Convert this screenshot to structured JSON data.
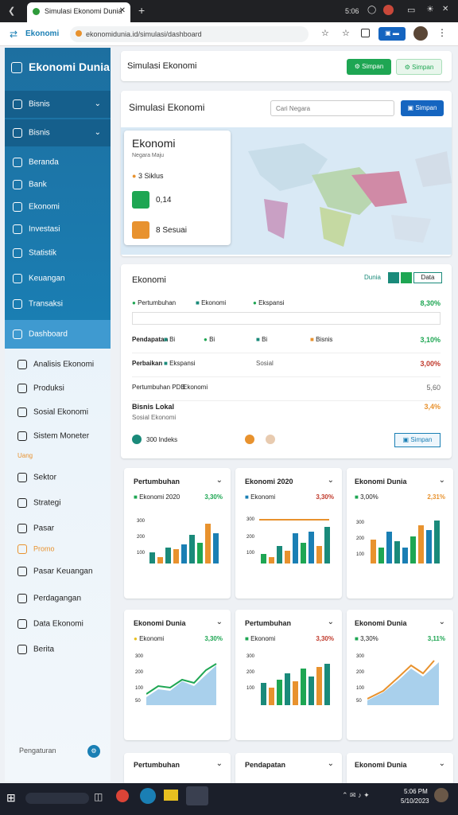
{
  "browser": {
    "tab_title": "Simulasi Ekonomi Dunia",
    "url": "ekonomidunia.id/simulasi/dashboard",
    "time": "5:06"
  },
  "brand": {
    "top_logo": "Ekonomi",
    "sidebar_title": "Ekonomi Dunia"
  },
  "sidebar": {
    "group1": "Bisnis",
    "group2": "Bisnis",
    "items_top": [
      "Beranda",
      "Bank",
      "Ekonomi",
      "Investasi",
      "Statistik",
      "Keuangan",
      "Transaksi"
    ],
    "active": "Dashboard",
    "items_bottom": [
      "Analisis Ekonomi",
      "Produksi",
      "Sosial Ekonomi",
      "Sistem Moneter",
      "Sektor",
      "Strategi",
      "Pasar",
      "Pasar Keuangan",
      "Perdagangan",
      "Data Ekonomi",
      "Berita"
    ],
    "promo_small": "Uang",
    "promo_tag": "Promo",
    "footer": "Pengaturan"
  },
  "header": {
    "title": "Simulasi Ekonomi",
    "btn1": "Simpan",
    "btn2": "Simpan"
  },
  "search": {
    "title": "Simulasi Ekonomi",
    "placeholder": "Cari Negara",
    "btn": "Simpan"
  },
  "map": {
    "heading": "Ekonomi",
    "sub": "Negara Maju",
    "stat1": "3 Siklus",
    "stat2": "0,14",
    "stat3": "8 Sesuai"
  },
  "summary": {
    "title": "Ekonomi",
    "controls": [
      "Dunia",
      "Data"
    ],
    "legend": [
      "Pertumbuhan",
      "Ekonomi",
      "Ekspansi"
    ],
    "legend_value": "8,30%",
    "rows": [
      {
        "label": "Pendapatan",
        "tags": [
          "Bi",
          "Bi",
          "Bi",
          "Bisnis"
        ],
        "value": "3,10%"
      },
      {
        "label": "Perbaikan",
        "tags": [
          "Ekspansi",
          "Sosial"
        ],
        "value": "3,00%"
      },
      {
        "label": "Pertumbuhan PDB",
        "tags": [
          "Ekonomi"
        ],
        "value": "5,60"
      },
      {
        "label": "Bisnis Lokal",
        "tags": [
          "Sosial Ekonomi"
        ],
        "value": "3,4%"
      }
    ],
    "footer_label": "300 Indeks",
    "footer_btn": "Simpan"
  },
  "charts_row1": [
    {
      "title": "Pertumbuhan",
      "legend": "Ekonomi 2020",
      "value": "3,30%"
    },
    {
      "title": "Ekonomi 2020",
      "legend": "Ekonomi",
      "value": "3,30%"
    },
    {
      "title": "Ekonomi Dunia",
      "legend": "3,00%",
      "value": "2,31%"
    }
  ],
  "charts_row2": [
    {
      "title": "Ekonomi Dunia",
      "legend": "Ekonomi",
      "value": "3,30%"
    },
    {
      "title": "Pertumbuhan",
      "legend": "Ekonomi",
      "value": "3,30%"
    },
    {
      "title": "Ekonomi Dunia",
      "legend": "3,30%",
      "value": "3,11%"
    }
  ],
  "charts_row3": [
    {
      "title": "Pertumbuhan"
    },
    {
      "title": "Pendapatan"
    },
    {
      "title": "Ekonomi Dunia"
    }
  ],
  "chart_axis": {
    "y1": "300",
    "y2": "200",
    "y3": "100",
    "y4": "50"
  },
  "colors": {
    "accent": "#1a7fb4",
    "green": "#1ea653",
    "orange": "#e8922e",
    "teal": "#1a8a7a",
    "red": "#c0392b"
  },
  "taskbar": {
    "time": "5:06 PM",
    "date": "5/10/2023"
  }
}
